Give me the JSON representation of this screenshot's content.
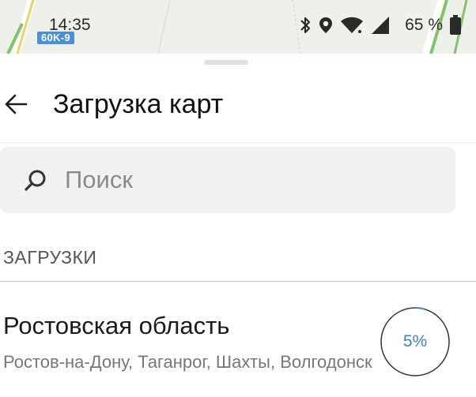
{
  "status_bar": {
    "time": "14:35",
    "battery_percent": "65 %",
    "icons": [
      "bluetooth-icon",
      "location-icon",
      "wifi-icon",
      "cell-signal-icon",
      "battery-icon"
    ]
  },
  "map": {
    "road_label": "60K-9"
  },
  "header": {
    "title": "Загрузка карт",
    "back_icon": "arrow-left-icon"
  },
  "search": {
    "placeholder": "Поиск",
    "icon": "search-icon"
  },
  "downloads": {
    "section_label": "ЗАГРУЗКИ",
    "items": [
      {
        "title": "Ростовская область",
        "subtitle": "Ростов-на-Дону, Таганрог, Шахты, Волгодонск",
        "progress_percent": 5,
        "progress_label": "5%"
      }
    ]
  },
  "colors": {
    "accent": "#3b7dd8",
    "road_badge": "#4a90d9"
  }
}
